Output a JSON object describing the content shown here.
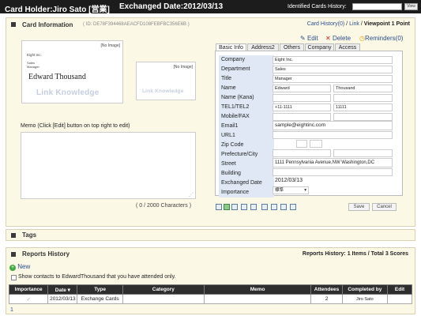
{
  "header": {
    "card_holder": "Card Holder:Jiro Sato [営業]",
    "exchanged": "Exchanged Date:2012/03/13",
    "history_label": "Identified Cards History:",
    "go_label": "View"
  },
  "card_info": {
    "title": "Card Information",
    "id_text": "( ID: DE78F394468AEACFD108FEBFBC356E6B )",
    "nav": {
      "history": "Card History(0)",
      "sep1": "/",
      "link": "Link",
      "sep2": "/",
      "viewpoint": "Viewpoint 1 Point"
    },
    "front": {
      "no_image": "[No Image]",
      "company": "Eight Inc.",
      "line1": "Sales",
      "line2": "Manager",
      "name": "Edward Thousand",
      "logo": "Link Knowledge"
    },
    "back": {
      "no_image": "[No Image]",
      "logo": "Link Knowledge"
    },
    "memo_label": "Memo (Click [Edit] button on top right to edit)",
    "char_count": "( 0 / 2000 Characters )",
    "actions": {
      "edit": "Edit",
      "delete": "Delete",
      "reminders": "Reminders(0)"
    },
    "tabs": [
      "Basic Info",
      "Address2",
      "Others",
      "Company",
      "Access"
    ],
    "fields": {
      "company": {
        "label": "Company",
        "value": "Eight Inc."
      },
      "department": {
        "label": "Department",
        "value": "Sales"
      },
      "title": {
        "label": "Title",
        "value": "Manager"
      },
      "name": {
        "label": "Name",
        "first": "Edward",
        "last": "Thousand"
      },
      "name_kana": {
        "label": "Name (Kana)"
      },
      "tel": {
        "label": "TEL1/TEL2",
        "tel1": "+11-1111",
        "tel2": "11111"
      },
      "mobile": {
        "label": "Mobile/FAX"
      },
      "email": {
        "label": "Email1",
        "value": "sample@eightinc.com"
      },
      "url": {
        "label": "URL1"
      },
      "zip": {
        "label": "Zip Code"
      },
      "prefecture": {
        "label": "Prefecture/City"
      },
      "street": {
        "label": "Street",
        "value": "1111 Pennsylvania Avenue,NW Washington,DC"
      },
      "building": {
        "label": "Building"
      },
      "exchanged": {
        "label": "Exchanged Date",
        "value": "2012/03/13"
      },
      "importance": {
        "label": "Importance",
        "value": "標準"
      }
    },
    "save": "Save",
    "cancel": "Cancel"
  },
  "tags": {
    "title": "Tags"
  },
  "reports": {
    "title": "Reports History",
    "summary": "Reports History: 1 Items / Total 3 Scores",
    "new": "New",
    "checkbox": "Show contacts to EdwardThousand that you have attended only.",
    "columns": [
      "Importance",
      "Date",
      "Type",
      "Category",
      "Memo",
      "Attendees",
      "Completed by",
      "Edit"
    ],
    "rows": [
      {
        "importance": "",
        "date": "2012/03/13",
        "type": "Exchange Cards",
        "category": "",
        "memo": "",
        "attendees": "2",
        "completed_by": "Jiro Sato",
        "edit": ""
      }
    ],
    "page": "1"
  }
}
